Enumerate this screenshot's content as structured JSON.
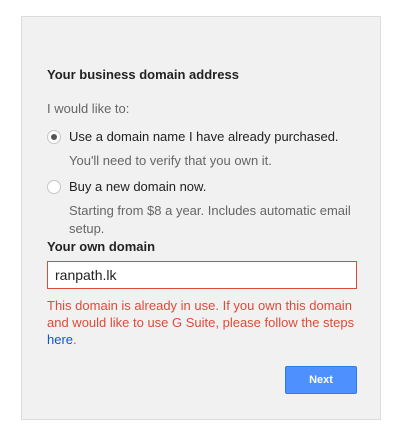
{
  "section_title": "Your business domain address",
  "prompt": "I would like to:",
  "options": [
    {
      "label": "Use a domain name I have already purchased.",
      "hint": "You'll need to verify that you own it.",
      "selected": true
    },
    {
      "label": "Buy a new domain now.",
      "hint": "Starting from $8 a year. Includes automatic email setup.",
      "selected": false
    }
  ],
  "own_domain": {
    "label": "Your own domain",
    "value": "ranpath.lk"
  },
  "error": {
    "message": "This domain is already in use. If you own this domain and would like to use G Suite, please follow the steps",
    "link_text": "here",
    "suffix": "."
  },
  "next_button": {
    "label": "Next"
  },
  "colors": {
    "error": "#dd4b39",
    "link": "#1155cc",
    "button": "#4d90fe"
  }
}
